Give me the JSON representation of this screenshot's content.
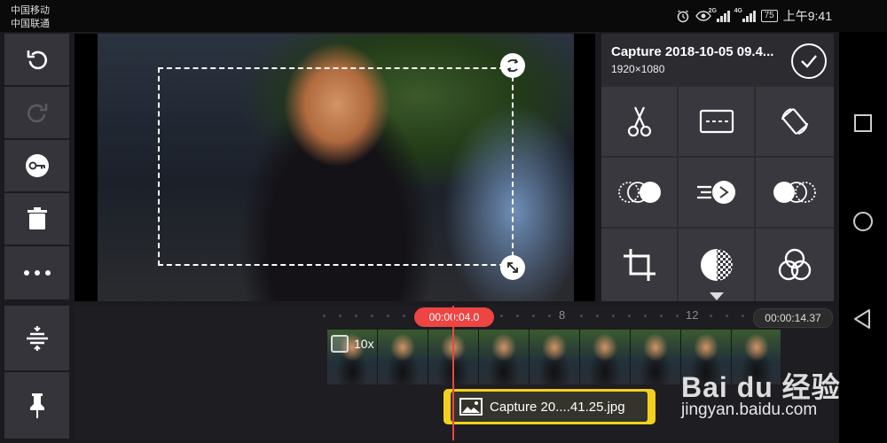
{
  "status_bar": {
    "carrier_1": "中国移动",
    "carrier_2": "中国联通",
    "net_1": "2G",
    "net_2": "4G",
    "battery": "75",
    "time": "上午9:41"
  },
  "left_toolbar": {
    "items": [
      {
        "icon": "undo-icon",
        "enabled": true
      },
      {
        "icon": "redo-icon",
        "enabled": false
      },
      {
        "icon": "keyframe-icon",
        "enabled": true
      },
      {
        "icon": "trash-icon",
        "enabled": true
      },
      {
        "icon": "more-icon",
        "enabled": true
      }
    ],
    "bottom_items": [
      {
        "icon": "track-adjust-icon"
      },
      {
        "icon": "pin-icon"
      }
    ]
  },
  "clip_panel": {
    "title": "Capture 2018-10-05 09.4...",
    "resolution": "1920×1080",
    "tools": [
      "scissors-icon",
      "split-screen-icon",
      "rotate-icon",
      "in-transition-icon",
      "speed-icon",
      "out-transition-icon",
      "crop-icon",
      "filter-icon",
      "blend-icon"
    ]
  },
  "timeline": {
    "current_time": "00:00:04.0",
    "total_time": "00:00:14.37",
    "ruler_labels": [
      "8",
      "12"
    ],
    "video_speed_label": "10x",
    "image_layer_name": "Capture 20....41.25.jpg"
  },
  "watermark": {
    "logo": "Bai du 经验",
    "url": "jingyan.baidu.com"
  },
  "colors": {
    "accent_red": "#ee4444",
    "layer_yellow": "#f2d11e",
    "panel_bg": "#2b2b30"
  }
}
